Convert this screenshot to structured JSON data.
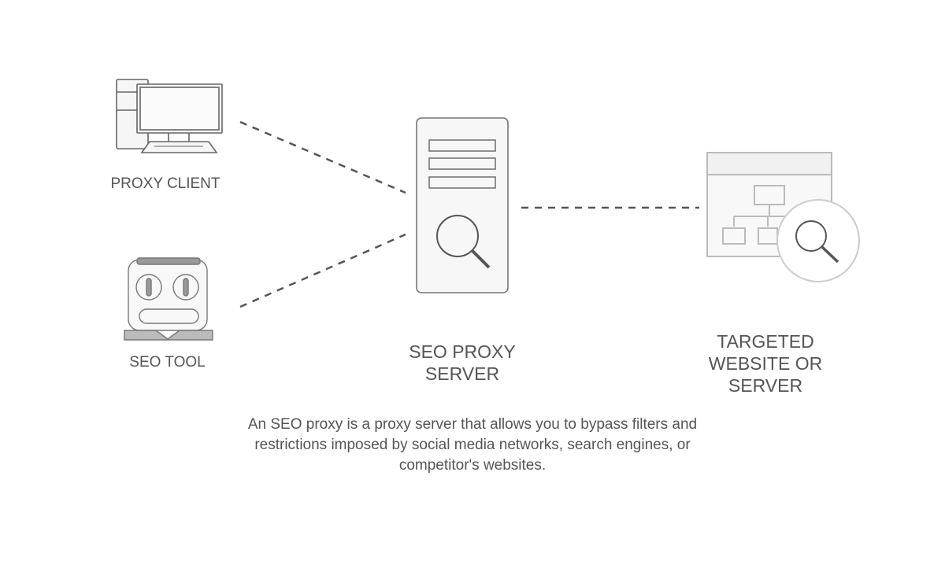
{
  "nodes": {
    "client": {
      "label": "PROXY CLIENT",
      "icon": "desktop-computer-icon"
    },
    "tool": {
      "label": "SEO TOOL",
      "icon": "robot-icon"
    },
    "server": {
      "label_line1": "SEO PROXY",
      "label_line2": "SERVER",
      "icon": "server-search-icon"
    },
    "target": {
      "label_line1": "TARGETED",
      "label_line2": "WEBSITE OR",
      "label_line3": "SERVER",
      "icon": "website-sitemap-search-icon"
    }
  },
  "caption": {
    "line1": "An SEO proxy is a proxy server that allows you to bypass filters and",
    "line2": "restrictions imposed by social media networks, search engines, or",
    "line3": "competitor's websites."
  },
  "colors": {
    "stroke": "#666666",
    "fill": "#f4f4f4",
    "dash": "#555555"
  }
}
